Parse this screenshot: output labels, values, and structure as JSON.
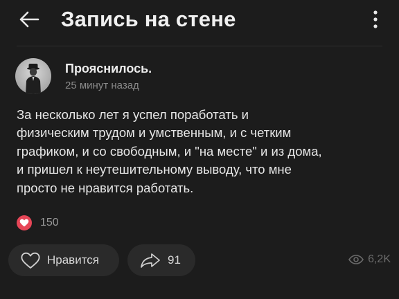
{
  "header": {
    "title": "Запись на стене"
  },
  "author": {
    "name": "Прояснилось.",
    "time": "25 минут назад"
  },
  "post": {
    "text": "За несколько лет я успел поработать и\nфизическим трудом и умственным, и с четким\nграфиком, и со свободным, и \"на месте\" и из дома,\nи пришел к неутешительному выводу, что мне\nпросто не нравится работать."
  },
  "reactions": {
    "count": "150",
    "icon": "heart-icon",
    "color": "#e64657"
  },
  "actions": {
    "like_label": "Нравится",
    "share_count": "91",
    "views": "6,2K"
  },
  "colors": {
    "background": "#1c1c1c",
    "pill": "#2a2a2a",
    "accent_red": "#e64657"
  }
}
